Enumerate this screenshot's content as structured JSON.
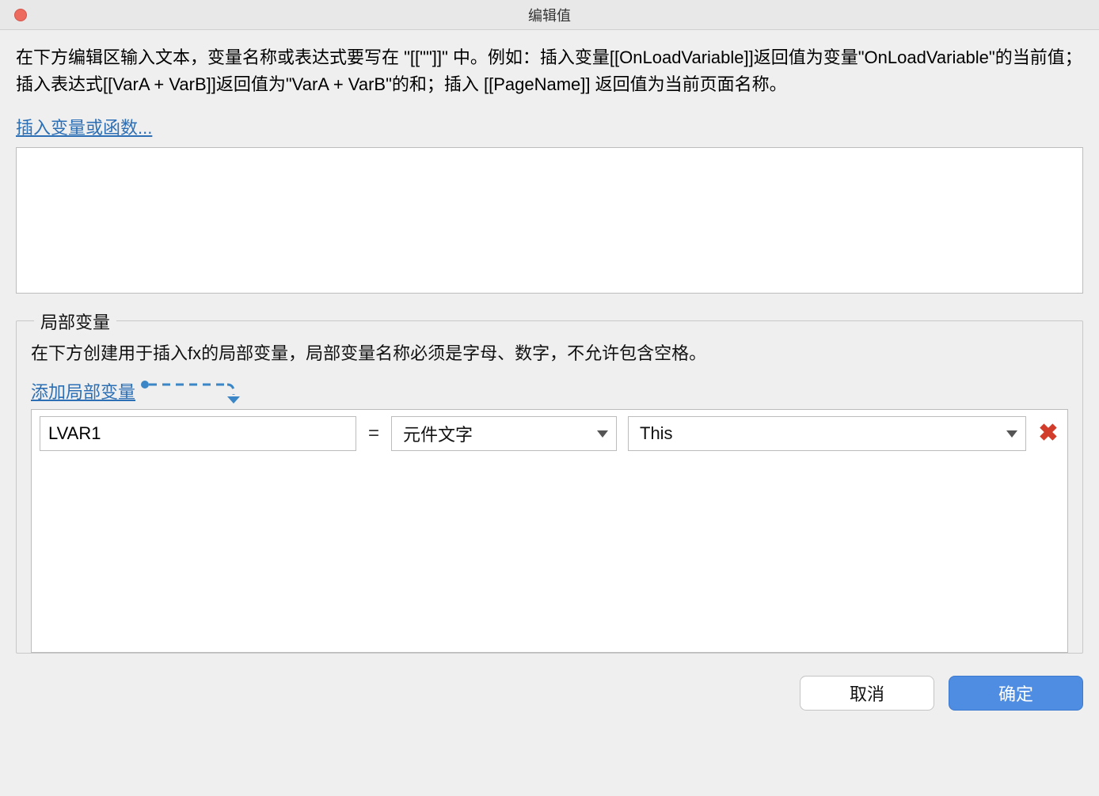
{
  "titlebar": {
    "title": "编辑值"
  },
  "help": {
    "text": "在下方编辑区输入文本，变量名称或表达式要写在 \"[[\"\"]]\" 中。例如：插入变量[[OnLoadVariable]]返回值为变量\"OnLoadVariable\"的当前值；插入表达式[[VarA + VarB]]返回值为\"VarA + VarB\"的和；插入 [[PageName]] 返回值为当前页面名称。"
  },
  "insert_link": "插入变量或函数...",
  "expression_value": "",
  "local_vars": {
    "legend": "局部变量",
    "help": "在下方创建用于插入fx的局部变量，局部变量名称必须是字母、数字，不允许包含空格。",
    "add_label": "添加局部变量",
    "rows": [
      {
        "name": "LVAR1",
        "type": "元件文字",
        "target": "This"
      }
    ]
  },
  "buttons": {
    "cancel": "取消",
    "ok": "确定"
  },
  "symbols": {
    "equals": "=",
    "delete": "✖"
  }
}
